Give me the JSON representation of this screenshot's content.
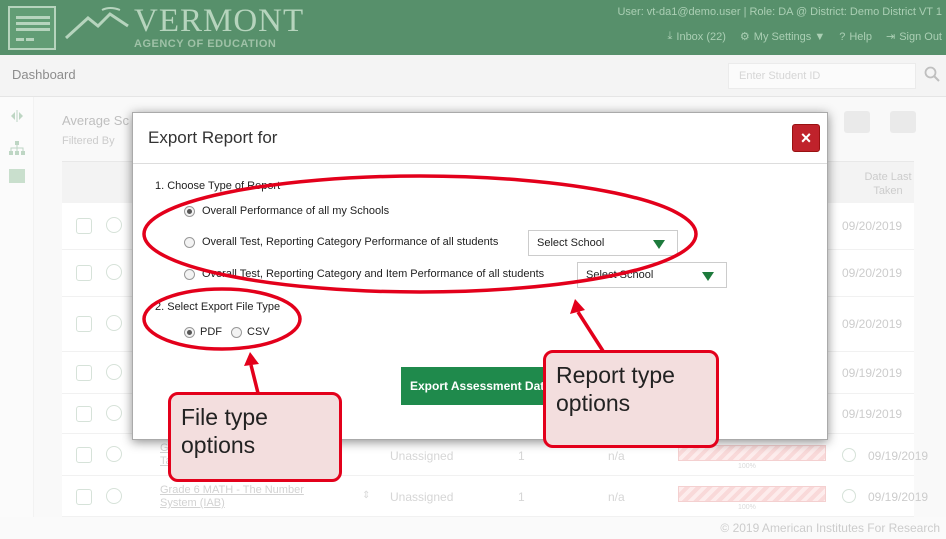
{
  "header": {
    "brand": "VERMONT",
    "agency": "AGENCY OF EDUCATION",
    "user_line": "User: vt-da1@demo.user  |  Role: DA @ District: Demo District VT 1",
    "inbox": "Inbox (22)",
    "settings": "My Settings ▼",
    "help": "Help",
    "signout": "Sign Out",
    "color": "#1f6b3a"
  },
  "subbar": {
    "title": "Dashboard",
    "search_placeholder": "Enter Student ID"
  },
  "main": {
    "heading": "Average Sc",
    "filtered": "Filtered By",
    "date_header": "Date Last Taken",
    "rows": [
      {
        "date": "09/20/2019"
      },
      {
        "date": "09/20/2019"
      },
      {
        "date": "09/20/2019"
      },
      {
        "date": "09/19/2019"
      },
      {
        "date": "09/19/2019"
      },
      {
        "name": "Grade\nTask -",
        "assign": "Unassigned",
        "count": "1",
        "score": "n/a",
        "pct": "100%",
        "date": "09/19/2019"
      },
      {
        "name": "Grade 6 MATH - The Number\nSystem (IAB)",
        "assign": "Unassigned",
        "count": "1",
        "score": "n/a",
        "pct": "100%",
        "date": "09/19/2019"
      }
    ]
  },
  "footer": {
    "copyright": "© 2019 American Institutes For Research"
  },
  "modal": {
    "title": "Export Report for",
    "close": "×",
    "step1": "1.   Choose Type of Report",
    "opt1": "Overall Performance of all my Schools",
    "opt2": "Overall Test, Reporting Category Performance of all students",
    "opt2_select": "Select School",
    "opt3": "Overall Test, Reporting Category and Item Performance of all students",
    "opt3_select": "Select School",
    "step2": "2.   Select Export File Type",
    "pdf": "PDF",
    "csv": "CSV",
    "export_button": "Export Assessment Data",
    "report_type_selected": "Overall Performance of all my Schools",
    "file_type_selected": "PDF"
  },
  "annotations": {
    "file_callout": "File type options",
    "report_callout": "Report type options",
    "color": "#e3001b"
  }
}
